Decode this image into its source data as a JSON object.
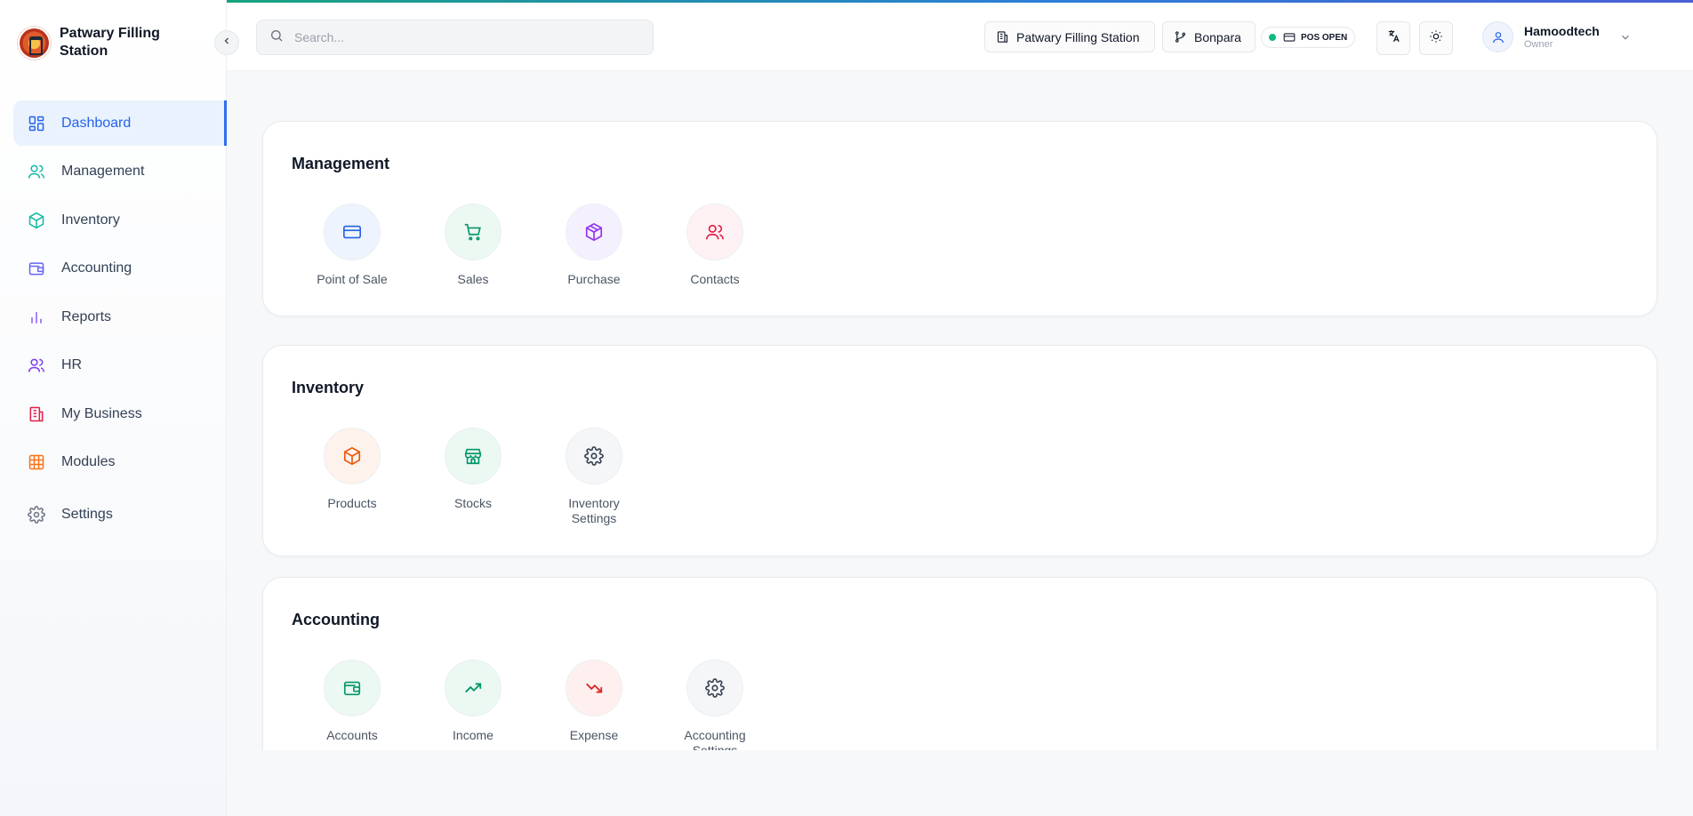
{
  "brand": {
    "name": "Patwary Filling Station"
  },
  "colors": {
    "accent": "#2563eb",
    "pos_open": "#10b981"
  },
  "sidebar": {
    "items": [
      {
        "label": "Dashboard",
        "icon": "dashboard-icon",
        "active": true
      },
      {
        "label": "Management",
        "icon": "users-icon"
      },
      {
        "label": "Inventory",
        "icon": "box-icon"
      },
      {
        "label": "Accounting",
        "icon": "wallet-icon"
      },
      {
        "label": "Reports",
        "icon": "bar-chart-icon"
      },
      {
        "label": "HR",
        "icon": "users-icon"
      },
      {
        "label": "My Business",
        "icon": "building-icon"
      },
      {
        "label": "Modules",
        "icon": "grid-icon"
      },
      {
        "label": "Settings",
        "icon": "gear-icon"
      }
    ]
  },
  "header": {
    "search_placeholder": "Search...",
    "station": "Patwary Filling Station",
    "branch": "Bonpara",
    "pos_status": "POS OPEN",
    "user": {
      "name": "Hamoodtech",
      "role": "Owner"
    }
  },
  "sections": [
    {
      "title": "Management",
      "tiles": [
        {
          "label": "Point of Sale",
          "icon": "credit-card-icon"
        },
        {
          "label": "Sales",
          "icon": "cart-icon"
        },
        {
          "label": "Purchase",
          "icon": "package-icon"
        },
        {
          "label": "Contacts",
          "icon": "users-icon"
        }
      ]
    },
    {
      "title": "Inventory",
      "tiles": [
        {
          "label": "Products",
          "icon": "box-icon"
        },
        {
          "label": "Stocks",
          "icon": "store-icon"
        },
        {
          "label": "Inventory Settings",
          "icon": "gear-icon"
        }
      ]
    },
    {
      "title": "Accounting",
      "tiles": [
        {
          "label": "Accounts",
          "icon": "wallet-icon"
        },
        {
          "label": "Income",
          "icon": "trending-up-icon"
        },
        {
          "label": "Expense",
          "icon": "trending-down-icon"
        },
        {
          "label": "Accounting Settings",
          "icon": "gear-icon"
        }
      ]
    }
  ]
}
